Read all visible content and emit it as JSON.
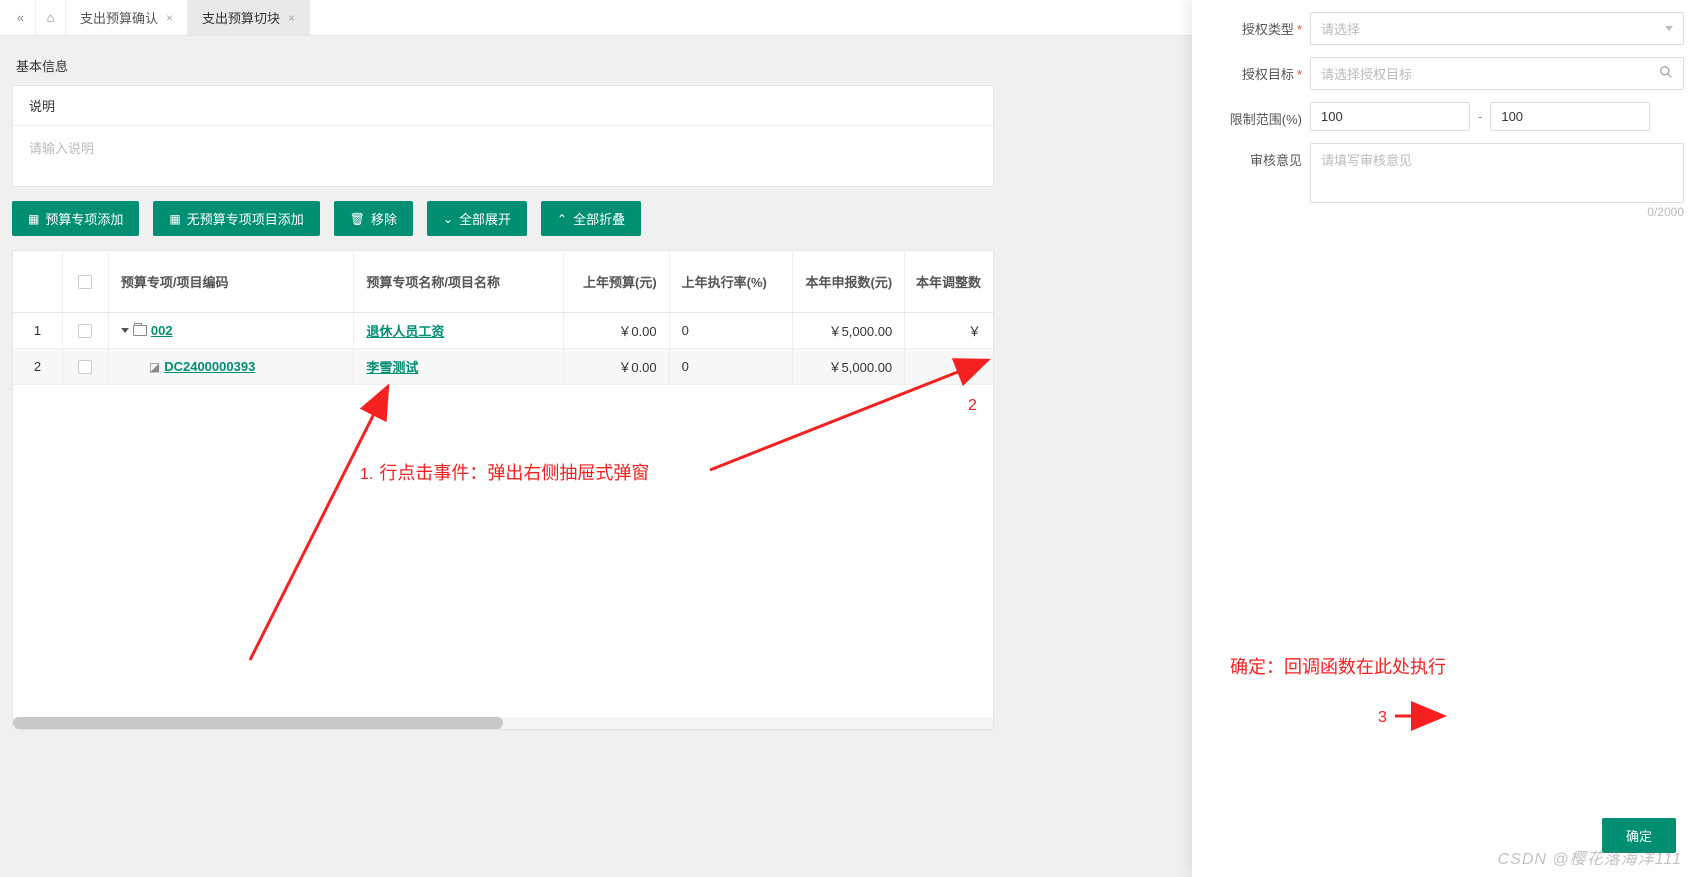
{
  "tabs": {
    "items": [
      {
        "label": "支出预算确认",
        "active": false
      },
      {
        "label": "支出预算切块",
        "active": true
      }
    ]
  },
  "section": {
    "basic_info_title": "基本信息"
  },
  "description": {
    "label": "说明",
    "placeholder": "请输入说明"
  },
  "toolbar": {
    "add_special": "预算专项添加",
    "add_project": "无预算专项项目添加",
    "remove": "移除",
    "expand_all": "全部展开",
    "collapse_all": "全部折叠"
  },
  "table": {
    "headers": {
      "code": "预算专项/项目编码",
      "name": "预算专项名称/项目名称",
      "prev_budget": "上年预算(元)",
      "prev_rate": "上年执行率(%)",
      "apply": "本年申报数(元)",
      "adjust": "本年调整数"
    },
    "rows": [
      {
        "idx": "1",
        "code": "002",
        "name": "退休人员工资",
        "prev": "￥0.00",
        "rate": "0",
        "apply": "￥5,000.00",
        "adj": "￥",
        "kind": "folder"
      },
      {
        "idx": "2",
        "code": "DC2400000393",
        "name": "李雪测试",
        "prev": "￥0.00",
        "rate": "0",
        "apply": "￥5,000.00",
        "adj": "￥",
        "kind": "leaf"
      }
    ]
  },
  "drawer": {
    "auth_type": {
      "label": "授权类型",
      "placeholder": "请选择"
    },
    "auth_target": {
      "label": "授权目标",
      "placeholder": "请选择授权目标"
    },
    "limit_range": {
      "label": "限制范围(%)",
      "from": "100",
      "to": "100",
      "sep": "-"
    },
    "review": {
      "label": "审核意见",
      "placeholder": "请填写审核意见",
      "counter": "0/2000"
    },
    "confirm": "确定"
  },
  "annotations": {
    "line1_prefix": "1.",
    "line1": "行点击事件：弹出右侧抽屉式弹窗",
    "num2": "2",
    "line2": "确定：回调函数在此处执行",
    "num3": "3"
  },
  "watermark": "CSDN @樱花落海洋111"
}
